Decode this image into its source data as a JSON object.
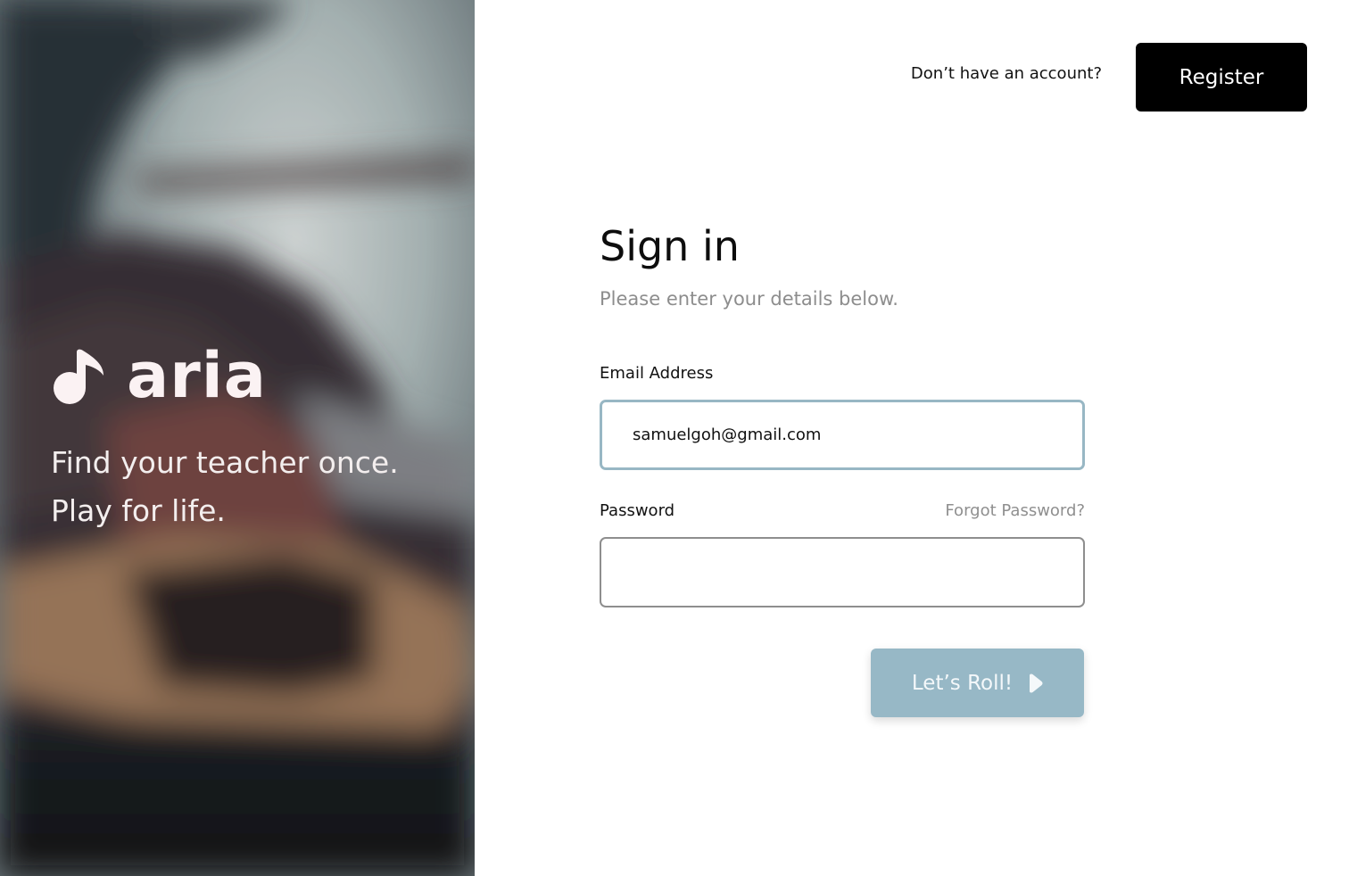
{
  "brand": {
    "name": "aria",
    "icon": "music-note-icon",
    "color": "#fbf2f3"
  },
  "hero": {
    "tagline_line1": "Find your teacher once.",
    "tagline_line2": "Play for life."
  },
  "header": {
    "question": "Don’t have an account?",
    "register_label": "Register"
  },
  "form": {
    "title": "Sign in",
    "subtitle": "Please enter your details below.",
    "email_label": "Email Address",
    "email_value": "samuelgoh@gmail.com",
    "password_label": "Password",
    "password_value": "",
    "forgot_label": "Forgot Password?",
    "submit_label": "Let’s Roll!",
    "submit_icon": "play-icon"
  },
  "colors": {
    "accent": "#97b8c6",
    "focus_border": "#98b7c4",
    "register_bg": "#000000",
    "muted_text": "#8d8d8d"
  }
}
